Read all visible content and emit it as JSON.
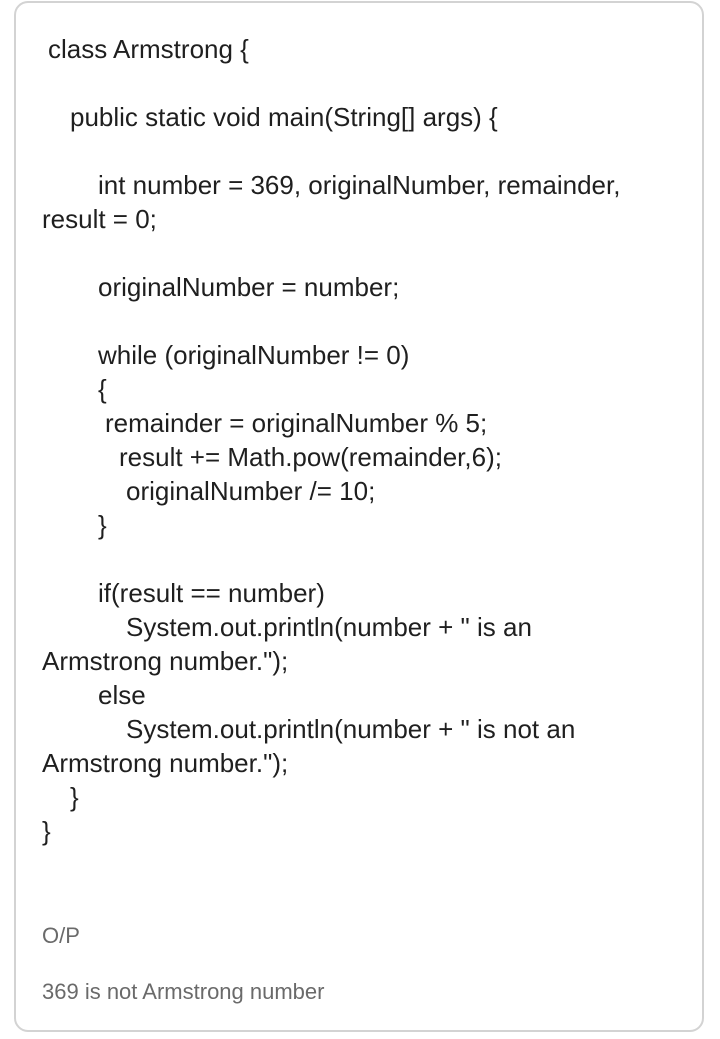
{
  "message": {
    "code_lines": [
      "class Armstrong {",
      "public static void main(String[] args) {",
      "int number = 369, originalNumber, remainder,",
      "result = 0;",
      "originalNumber = number;",
      "while (originalNumber != 0)",
      "{",
      "remainder = originalNumber % 5;",
      "result += Math.pow(remainder,6);",
      "originalNumber /= 10;",
      "}",
      "if(result == number)",
      "System.out.println(number + \" is an",
      "Armstrong number.\");",
      "else",
      "System.out.println(number + \" is not an",
      "Armstrong number.\");",
      "}",
      "}"
    ],
    "output_label": "O/P",
    "output_text": "369 is not Armstrong number"
  }
}
